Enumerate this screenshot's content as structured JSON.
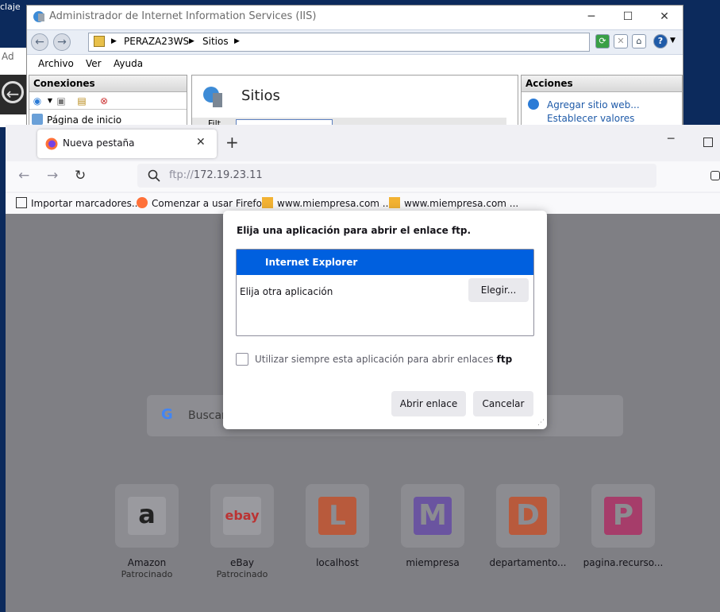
{
  "desktop": {
    "label": "claje",
    "partial_left": "Ad"
  },
  "iis": {
    "title": "Administrador de Internet Information Services (IIS)",
    "window_controls": {
      "minimize": "─",
      "maximize": "☐",
      "close": "✕"
    },
    "address": {
      "path": [
        "PERAZA23WS",
        "Sitios"
      ],
      "separator": "▶"
    },
    "menu": [
      "Archivo",
      "Ver",
      "Ayuda"
    ],
    "connections": {
      "header": "Conexiones",
      "item": "Página de inicio"
    },
    "center": {
      "title": "Sitios",
      "filter_label": "Filt"
    },
    "actions": {
      "header": "Acciones",
      "links": [
        "Agregar sitio web...",
        "Establecer valores"
      ]
    }
  },
  "firefox": {
    "tab": {
      "title": "Nueva pestaña",
      "close": "✕"
    },
    "new_tab": "+",
    "minimize": "─",
    "url": "ftp://172.19.23.11",
    "url_scheme": "ftp://",
    "url_host": "172.19.23.11",
    "bookmarks": [
      {
        "label": "Importar marcadores...",
        "icon": "import-icon"
      },
      {
        "label": "Comenzar a usar Firefox",
        "icon": "firefox-icon"
      },
      {
        "label": "www.miempresa.com ...",
        "icon": "pma-icon"
      },
      {
        "label": "www.miempresa.com ...",
        "icon": "pma-icon"
      }
    ],
    "search": {
      "placeholder": "Buscar"
    },
    "top_sites": [
      {
        "label": "Amazon",
        "sponsor": "Patrocinado",
        "glyph": "a",
        "bg": "#ffffff",
        "fg": "#111111"
      },
      {
        "label": "eBay",
        "sponsor": "Patrocinado",
        "glyph": "ebay",
        "bg": "#ffffff",
        "fg": "#e53238"
      },
      {
        "label": "localhost",
        "sponsor": "",
        "glyph": "L",
        "bg": "#e8552d",
        "fg": "#ffffff"
      },
      {
        "label": "miempresa",
        "sponsor": "",
        "glyph": "M",
        "bg": "#7a4fc9",
        "fg": "#ffffff"
      },
      {
        "label": "departamento...",
        "sponsor": "",
        "glyph": "D",
        "bg": "#e8552d",
        "fg": "#ffffff"
      },
      {
        "label": "pagina.recurso...",
        "sponsor": "",
        "glyph": "P",
        "bg": "#d6186a",
        "fg": "#ffffff"
      }
    ]
  },
  "dialog": {
    "title": "Elija una aplicación para abrir el enlace ftp.",
    "selected_app": "Internet Explorer",
    "other_app": "Elija otra aplicación",
    "choose_button": "Elegir...",
    "checkbox_label_prefix": "Utilizar siempre esta aplicación para abrir enlaces",
    "checkbox_label_bold": "ftp",
    "checkbox_checked": false,
    "open_button": "Abrir enlace",
    "cancel_button": "Cancelar"
  },
  "colors": {
    "accent": "#0060df",
    "dim_overlay": "#7f7f84",
    "iis_link": "#1e5aa8"
  }
}
